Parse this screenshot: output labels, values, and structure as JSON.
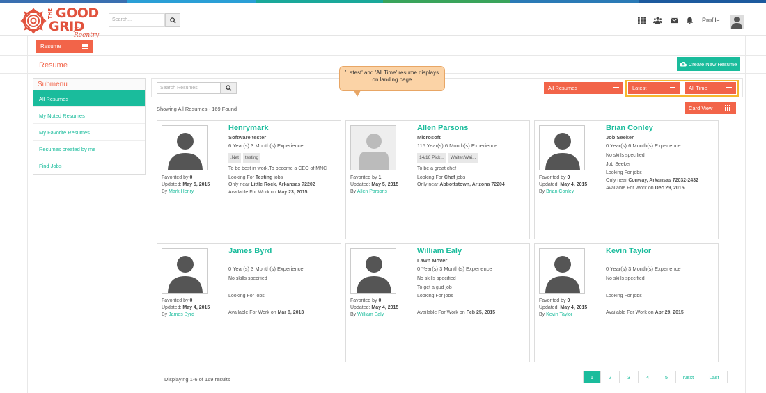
{
  "colors": {
    "brand": "#f26449",
    "accent": "#1abc9c",
    "highlight": "#f5b82e",
    "stripe": [
      "#3a6fb0",
      "#2a9fd6",
      "#1aa89a",
      "#3aa45b",
      "#2a7ab6",
      "#1c5a9e"
    ]
  },
  "header": {
    "logo": {
      "the": "THE",
      "good": "GOOD",
      "grid": "GRID",
      "tagline": "for Reentry"
    },
    "search": {
      "placeholder": "Search..."
    },
    "icons": [
      "apps-icon",
      "people-icon",
      "mail-icon",
      "bell-icon"
    ],
    "profile_label": "Profile"
  },
  "tab": {
    "label": "Resume"
  },
  "page": {
    "title": "Resume",
    "create_button": "Create New Resume"
  },
  "submenu": {
    "title": "Submenu",
    "items": [
      {
        "label": "All Resumes",
        "active": true
      },
      {
        "label": "My Noted Resumes"
      },
      {
        "label": "My Favorite Resumes"
      },
      {
        "label": "Resumes created by me"
      },
      {
        "label": "Find Jobs"
      }
    ]
  },
  "toolbar": {
    "search_placeholder": "Search Resumes",
    "filter_label": "All Resumes",
    "sort_label": "Latest",
    "time_label": "All Time",
    "showing": "Showing All Resumes - 169 Found",
    "view_label": "Card View"
  },
  "callout": {
    "text": "'Latest' and 'All Time' resume displays on landing page"
  },
  "cards": [
    {
      "name": "Henrymark",
      "role": "Software tester",
      "experience": "6 Year(s) 3 Month(s) Experience",
      "tags": [
        ".Net",
        "testing"
      ],
      "objective": "To be best in work.To become a CEO of MNC",
      "looking_prefix": "Looking For",
      "looking_value": "Testing",
      "looking_suffix": "jobs",
      "near_prefix": "Only near",
      "near_value": "Little Rock, Arkansas 72202",
      "available_prefix": "Available For Work on",
      "available_value": "May 23, 2015",
      "favorited_label": "Favorited by",
      "favorited_value": "0",
      "updated_label": "Updated:",
      "updated_value": "May 5, 2015",
      "by_label": "By",
      "by_value": "Mark Henry"
    },
    {
      "name": "Allen Parsons",
      "role": "Microsoft",
      "experience": "115 Year(s) 6 Month(s) Experience",
      "tags": [
        "14/16 Pick...",
        "Waiter/Wai..."
      ],
      "objective": "To be a great chef",
      "looking_prefix": "Looking For",
      "looking_value": "Chef",
      "looking_suffix": "jobs",
      "near_prefix": "Only near",
      "near_value": "Abbottstown, Arizona 72204",
      "favorited_label": "Favorited by",
      "favorited_value": "1",
      "updated_label": "Updated:",
      "updated_value": "May 5, 2015",
      "by_label": "By",
      "by_value": "Allen Parsons"
    },
    {
      "name": "Brian Conley",
      "role": "Job Seeker",
      "experience": "0 Year(s) 6 Month(s) Experience",
      "skills": "No skills specified",
      "objective": "Job Seeker",
      "looking_prefix": "Looking For",
      "looking_suffix": "jobs",
      "near_prefix": "Only near",
      "near_value": "Conway, Arkansas 72032-2432",
      "available_prefix": "Available For Work on",
      "available_value": "Dec 29, 2015",
      "favorited_label": "Favorited by",
      "favorited_value": "0",
      "updated_label": "Updated:",
      "updated_value": "May 4, 2015",
      "by_label": "By",
      "by_value": "Brian Conley"
    },
    {
      "name": "James Byrd",
      "experience": "0 Year(s) 3 Month(s) Experience",
      "skills": "No skills specified",
      "looking_prefix": "Looking For",
      "looking_suffix": "jobs",
      "available_prefix": "Available For Work on",
      "available_value": "Mar 8, 2013",
      "favorited_label": "Favorited by",
      "favorited_value": "0",
      "updated_label": "Updated:",
      "updated_value": "May 4, 2015",
      "by_label": "By",
      "by_value": "James Byrd"
    },
    {
      "name": "William Ealy",
      "role": "Lawn Mover",
      "experience": "0 Year(s) 3 Month(s) Experience",
      "skills": "No skills specified",
      "objective": "To get a gud job",
      "looking_prefix": "Looking For",
      "looking_suffix": "jobs",
      "available_prefix": "Available For Work on",
      "available_value": "Feb 25, 2015",
      "favorited_label": "Favorited by",
      "favorited_value": "0",
      "updated_label": "Updated:",
      "updated_value": "May 4, 2015",
      "by_label": "By",
      "by_value": "William Ealy"
    },
    {
      "name": "Kevin Taylor",
      "experience": "0 Year(s) 3 Month(s) Experience",
      "skills": "No skills specified",
      "looking_prefix": "Looking For",
      "looking_suffix": "jobs",
      "available_prefix": "Available For Work on",
      "available_value": "Apr 29, 2015",
      "favorited_label": "Favorited by",
      "favorited_value": "0",
      "updated_label": "Updated:",
      "updated_value": "May 4, 2015",
      "by_label": "By",
      "by_value": "Kevin Taylor"
    }
  ],
  "pagination": {
    "summary": "Displaying 1-6 of 169 results",
    "pages": [
      "1",
      "2",
      "3",
      "4",
      "5",
      "Next",
      "Last"
    ],
    "current": "1"
  }
}
